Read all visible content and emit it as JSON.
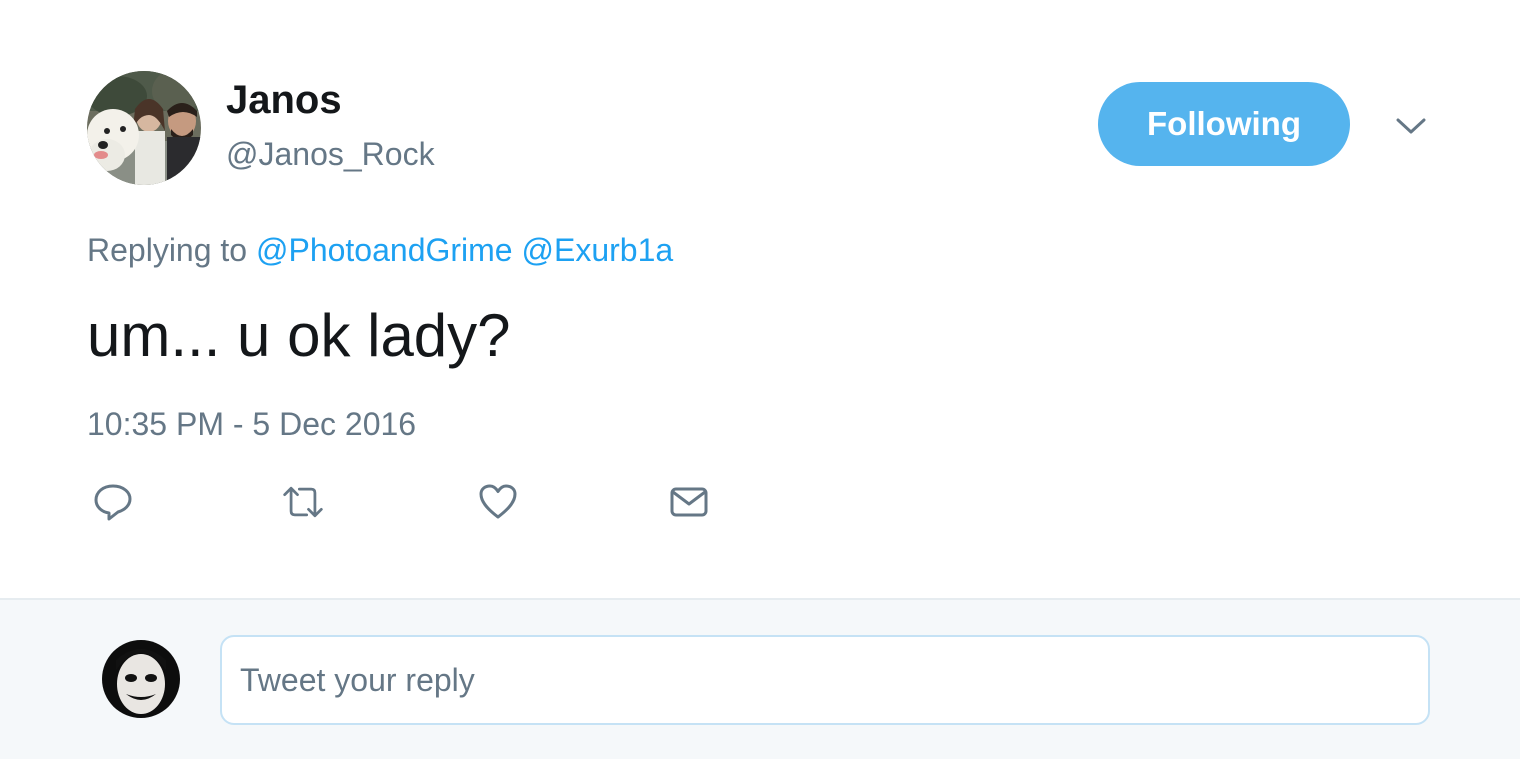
{
  "author": {
    "name": "Janos",
    "handle": "@Janos_Rock",
    "avatar_icon": "profile-photo-dog-couple"
  },
  "follow_button": {
    "label": "Following",
    "color": "#55b4ee"
  },
  "caret_icon": "chevron-down-icon",
  "reply_context": {
    "prefix": "Replying to",
    "mentions": [
      "@PhotoandGrime",
      "@Exurb1a"
    ],
    "mention_color": "#1da1f2"
  },
  "tweet": {
    "text": "um... u ok lady?",
    "timestamp": "10:35 PM - 5 Dec 2016"
  },
  "actions": [
    {
      "icon": "reply-icon"
    },
    {
      "icon": "retweet-icon"
    },
    {
      "icon": "like-heart-icon"
    },
    {
      "icon": "direct-message-envelope-icon"
    }
  ],
  "reply_box": {
    "placeholder": "Tweet your reply",
    "avatar_icon": "user-avatar-face"
  }
}
